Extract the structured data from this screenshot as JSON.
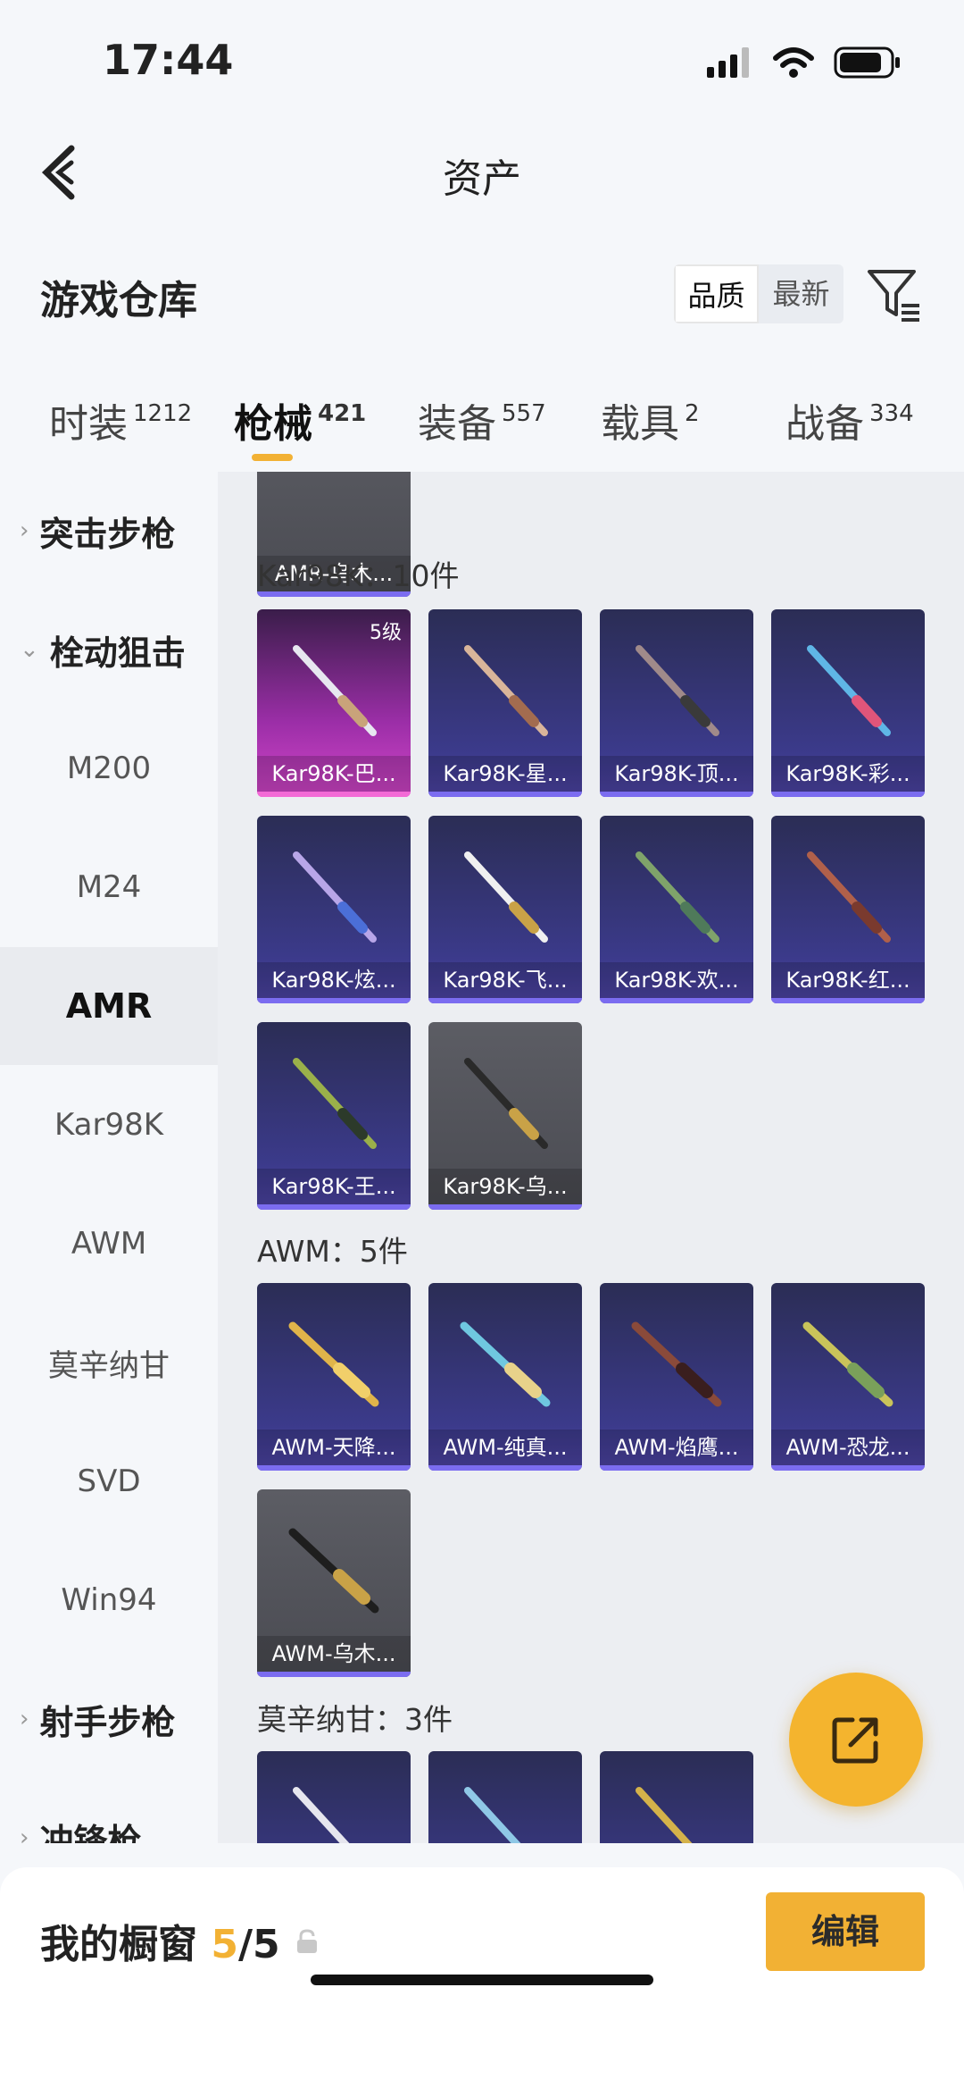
{
  "status": {
    "time": "17:44"
  },
  "nav": {
    "title": "资产"
  },
  "toolbar": {
    "title": "游戏仓库",
    "sort_options": [
      "品质",
      "最新"
    ]
  },
  "tabs": [
    {
      "label": "时装",
      "count": "1212"
    },
    {
      "label": "枪械",
      "count": "421"
    },
    {
      "label": "装备",
      "count": "557"
    },
    {
      "label": "载具",
      "count": "2"
    },
    {
      "label": "战备",
      "count": "334"
    }
  ],
  "sidebar": [
    {
      "label": "突击步枪",
      "type": "group",
      "chevron": "›"
    },
    {
      "label": "栓动狙击",
      "type": "group",
      "chevron": "⌄"
    },
    {
      "label": "M200",
      "type": "item"
    },
    {
      "label": "M24",
      "type": "item"
    },
    {
      "label": "AMR",
      "type": "item",
      "active": true
    },
    {
      "label": "Kar98K",
      "type": "item"
    },
    {
      "label": "AWM",
      "type": "item"
    },
    {
      "label": "莫辛纳甘",
      "type": "item"
    },
    {
      "label": "SVD",
      "type": "item"
    },
    {
      "label": "Win94",
      "type": "item"
    },
    {
      "label": "射手步枪",
      "type": "group",
      "chevron": "›"
    },
    {
      "label": "冲锋枪",
      "type": "group",
      "chevron": "›"
    }
  ],
  "sections": {
    "amr": {
      "items": [
        {
          "name": "AMR-乌木...",
          "style": "gray"
        }
      ]
    },
    "kar98k": {
      "title": "Kar98K：10件",
      "items": [
        {
          "name": "Kar98K-巴...",
          "style": "pink",
          "level": "5级"
        },
        {
          "name": "Kar98K-星...",
          "style": "purple"
        },
        {
          "name": "Kar98K-顶...",
          "style": "purple"
        },
        {
          "name": "Kar98K-彩...",
          "style": "purple"
        },
        {
          "name": "Kar98K-炫...",
          "style": "purple"
        },
        {
          "name": "Kar98K-飞...",
          "style": "purple"
        },
        {
          "name": "Kar98K-欢...",
          "style": "purple"
        },
        {
          "name": "Kar98K-红...",
          "style": "purple"
        },
        {
          "name": "Kar98K-王...",
          "style": "purple"
        },
        {
          "name": "Kar98K-乌...",
          "style": "gray"
        }
      ]
    },
    "awm": {
      "title": "AWM：5件",
      "items": [
        {
          "name": "AWM-天降...",
          "style": "purple"
        },
        {
          "name": "AWM-纯真...",
          "style": "purple"
        },
        {
          "name": "AWM-焰鹰...",
          "style": "purple"
        },
        {
          "name": "AWM-恐龙...",
          "style": "purple"
        },
        {
          "name": "AWM-乌木...",
          "style": "gray"
        }
      ]
    },
    "mosin": {
      "title": "莫辛纳甘：3件"
    }
  },
  "bottom": {
    "showcase_label": "我的橱窗",
    "showcase_used": "5",
    "showcase_total": "/5",
    "edit_label": "编辑"
  },
  "colors": {
    "accent": "#f2b134",
    "rare_purple": "#3b3a8a",
    "legendary_pink": "#d246c9",
    "common_gray": "#55565c"
  },
  "icons": [
    "back-arrow-icon",
    "filter-icon",
    "signal-icon",
    "wifi-icon",
    "battery-icon",
    "share-out-icon",
    "lock-icon",
    "chevron-right-icon",
    "chevron-down-icon"
  ]
}
